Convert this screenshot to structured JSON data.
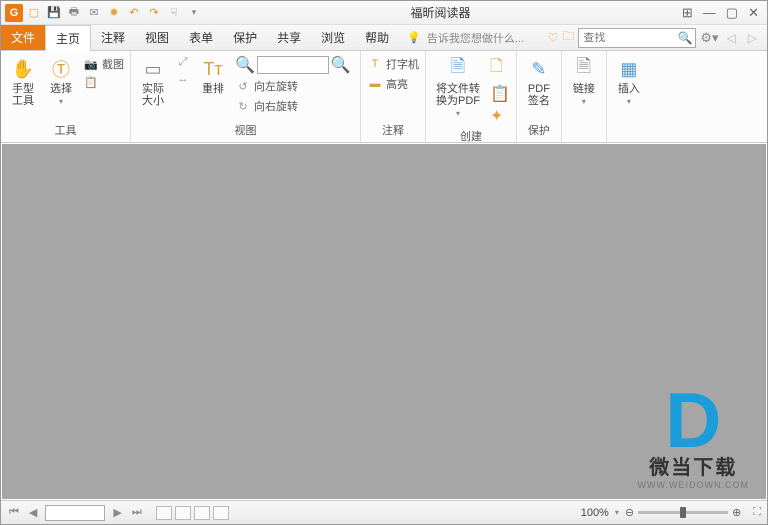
{
  "app": {
    "title": "福昕阅读器"
  },
  "tabs": {
    "file": "文件",
    "home": "主页",
    "annot": "注释",
    "view": "视图",
    "form": "表单",
    "protect": "保护",
    "share": "共享",
    "browse": "浏览",
    "help": "帮助"
  },
  "help_hint": "告诉我您想做什么...",
  "search": {
    "placeholder": "查找"
  },
  "ribbon": {
    "tools": {
      "label": "工具",
      "hand": "手型\n工具",
      "select": "选择",
      "screenshot": "截图"
    },
    "view": {
      "label": "视图",
      "actual": "实际\n大小",
      "reflow": "重排",
      "rotl": "向左旋转",
      "rotr": "向右旋转"
    },
    "annot": {
      "label": "注释",
      "typewriter": "打字机",
      "highlight": "高亮"
    },
    "create": {
      "label": "创建",
      "topdf": "将文件转\n换为PDF"
    },
    "protect": {
      "label": "保护",
      "sign": "PDF\n签名"
    },
    "link": "链接",
    "insert": "插入"
  },
  "status": {
    "zoom": "100%"
  },
  "watermark": {
    "brand": "微当下载",
    "url": "WWW.WEIDOWN.COM"
  }
}
